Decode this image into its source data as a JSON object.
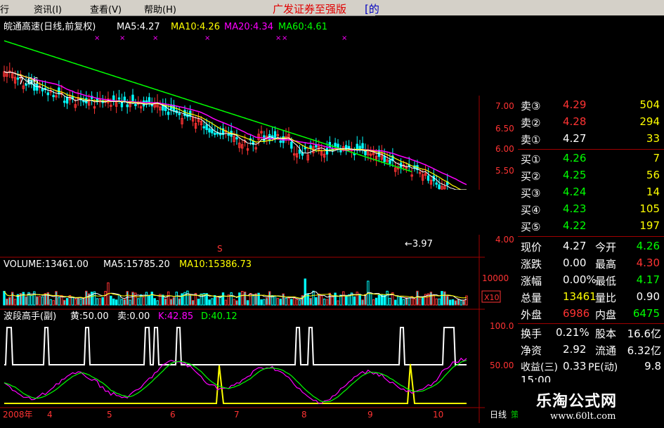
{
  "menu": {
    "items": [
      "行",
      "资讯(I)",
      "查看(V)",
      "帮助(H)"
    ],
    "brand": "广发证券至强版",
    "brand_tail": "[的"
  },
  "main_chart": {
    "title": "皖通高速(日线,前复权)",
    "ma5": "MA5:4.27",
    "ma10": "MA10:4.26",
    "ma20": "MA20:4.34",
    "ma60": "MA60:4.61",
    "high_marker": "7.66",
    "low_marker": "←3.97",
    "s_label": "S",
    "price_ticks": [
      "7.00",
      "6.50",
      "6.00",
      "5.50",
      "4.00"
    ]
  },
  "volume_panel": {
    "volume": "VOLUME:13461.00",
    "ma5": "MA5:15785.20",
    "ma10": "MA10:15386.73",
    "tick": "10000",
    "unit": "X10"
  },
  "indicator_panel": {
    "name": "波段高手(副)",
    "huang": "黄:50.00",
    "sell": "卖:0.00",
    "k": "K:42.85",
    "d": "D:40.12",
    "ticks": [
      "100.0",
      "50.00"
    ]
  },
  "time_axis": {
    "labels": [
      "2008年",
      "4",
      "5",
      "6",
      "7",
      "8",
      "9",
      "10"
    ],
    "period": "日线",
    "extra": "策"
  },
  "quote": {
    "sells": [
      {
        "label": "卖③",
        "price": "4.29",
        "vol": "504"
      },
      {
        "label": "卖②",
        "price": "4.28",
        "vol": "294"
      },
      {
        "label": "卖①",
        "price": "4.27",
        "vol": "33"
      }
    ],
    "buys": [
      {
        "label": "买①",
        "price": "4.26",
        "vol": "7"
      },
      {
        "label": "买②",
        "price": "4.25",
        "vol": "56"
      },
      {
        "label": "买③",
        "price": "4.24",
        "vol": "14"
      },
      {
        "label": "买④",
        "price": "4.23",
        "vol": "105"
      },
      {
        "label": "买⑤",
        "price": "4.22",
        "vol": "197"
      }
    ],
    "stats": [
      {
        "l1": "现价",
        "v1": "4.27",
        "l2": "今开",
        "v2": "4.26"
      },
      {
        "l1": "涨跌",
        "v1": "0.00",
        "l2": "最高",
        "v2": "4.30"
      },
      {
        "l1": "涨幅",
        "v1": "0.00%",
        "l2": "最低",
        "v2": "4.17"
      },
      {
        "l1": "总量",
        "v1": "13461",
        "l2": "量比",
        "v2": "0.90"
      },
      {
        "l1": "外盘",
        "v1": "6986",
        "l2": "内盘",
        "v2": "6475"
      },
      {
        "l1": "换手",
        "v1": "0.21%",
        "l2": "股本",
        "v2": "16.6亿"
      },
      {
        "l1": "净资",
        "v1": "2.92",
        "l2": "流通",
        "v2": "6.32亿"
      },
      {
        "l1": "收益(三)",
        "v1": "0.33",
        "l2": "PE(动)",
        "v2": "9.8"
      }
    ],
    "partial_row": "15:00"
  },
  "watermark": {
    "title": "乐淘公式网",
    "url": "www.60lt.com"
  },
  "colors": {
    "up": "#ff3333",
    "down": "#00ffff",
    "ma5": "#ffffff",
    "ma10": "#ffff00",
    "ma20": "#ff00ff",
    "ma60": "#00ff00",
    "axis_red": "#a00000"
  }
}
